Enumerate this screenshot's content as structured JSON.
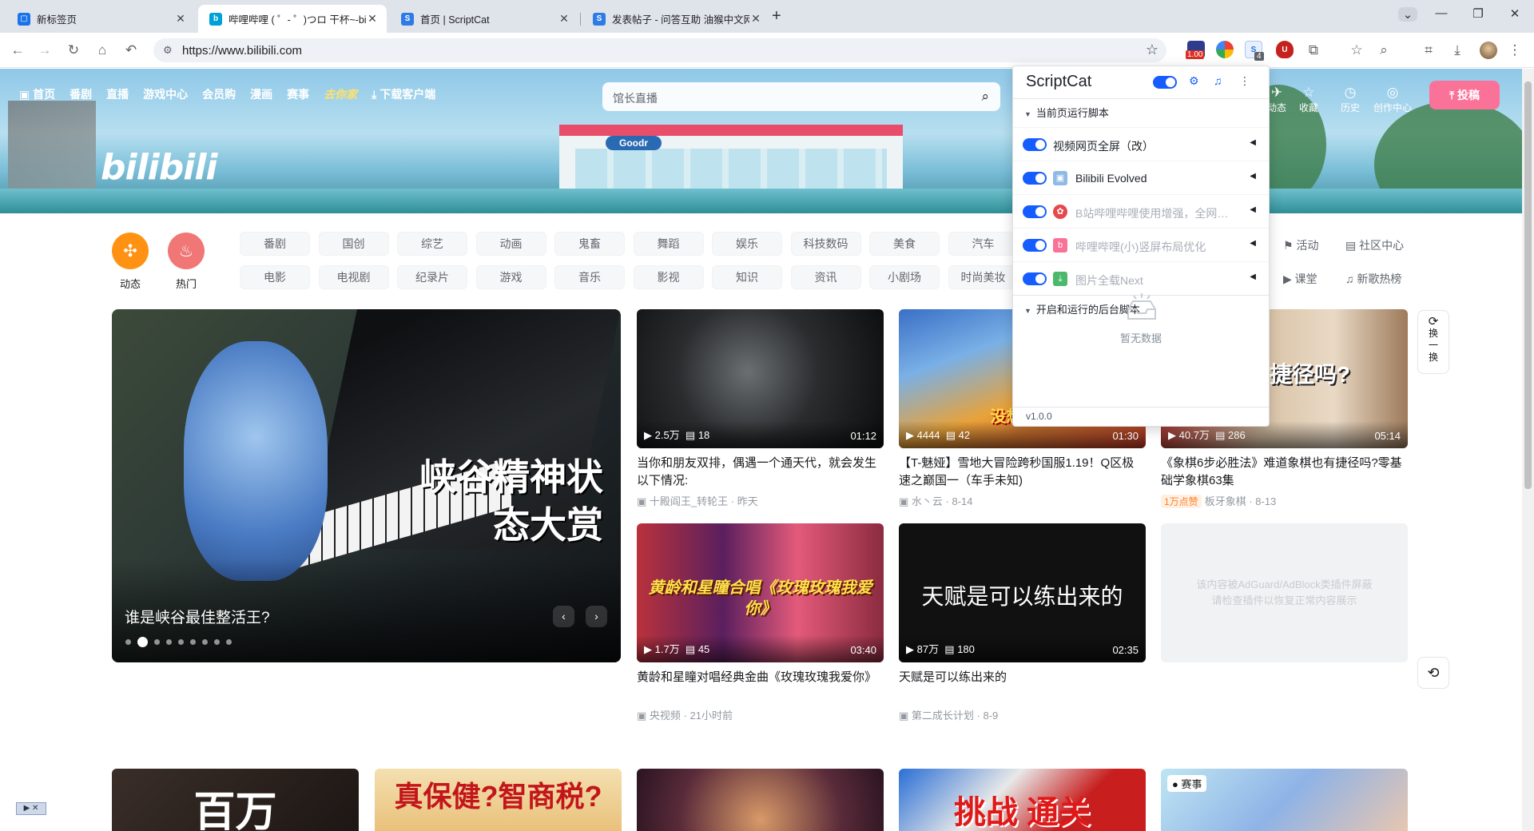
{
  "browser": {
    "tabs": [
      {
        "title": "新标签页"
      },
      {
        "title": "哔哩哔哩 ( ゜- ゜)つロ 干杯~-bilibili"
      },
      {
        "title": "首页 | ScriptCat"
      },
      {
        "title": "发表帖子 - 问答互助 油猴中文网"
      }
    ],
    "url": "https://www.bilibili.com",
    "ext_badge_counts": [
      "1.00",
      "4"
    ]
  },
  "bili": {
    "logo": "bilibili",
    "nav": [
      "首页",
      "番剧",
      "直播",
      "游戏中心",
      "会员购",
      "漫画",
      "赛事",
      "去你家",
      "下载客户端"
    ],
    "search_placeholder": "馆长直播",
    "right_nav": [
      "动态",
      "收藏",
      "历史",
      "创作中心"
    ],
    "upload": "投稿",
    "circles": [
      "动态",
      "热门"
    ],
    "channels_row1": [
      "番剧",
      "国创",
      "综艺",
      "动画",
      "鬼畜",
      "舞蹈",
      "娱乐",
      "科技数码",
      "美食",
      "汽车"
    ],
    "channels_row2": [
      "电影",
      "电视剧",
      "纪录片",
      "游戏",
      "音乐",
      "影视",
      "知识",
      "资讯",
      "小剧场",
      "时尚美妆"
    ],
    "side_links": [
      "活动",
      "社区中心",
      "课堂",
      "新歌热榜"
    ],
    "hero": {
      "big_text": "峡谷精神状态大赏",
      "title": "谁是峡谷最佳整活王?"
    },
    "cards": [
      {
        "views": "2.5万",
        "danmaku": "18",
        "duration": "01:12",
        "title": "当你和朋友双排，偶遇一个通天代，就会发生以下情况:",
        "author": "十殿阎王_转轮王",
        "date": "昨天",
        "badge": ""
      },
      {
        "views": "4444",
        "danmaku": "42",
        "duration": "01:30",
        "title": "【T-魅娅】雪地大冒险跨秒国服1.19！Q区极速之巅国一（车手未知)",
        "author": "水丶云",
        "date": "8-14",
        "badge": "",
        "thumb_text": "没想到加"
      },
      {
        "views": "40.7万",
        "danmaku": "286",
        "duration": "05:14",
        "title": "《象棋6步必胜法》难道象棋也有捷径吗?零基础学象棋63集",
        "author": "板牙象棋",
        "date": "8-13",
        "badge": "1万点赞",
        "thumb_text": "必胜 捷径吗?"
      },
      {
        "views": "1.7万",
        "danmaku": "45",
        "duration": "03:40",
        "title": "黄龄和星瞳对唱经典金曲《玫瑰玫瑰我爱你》",
        "author": "央视频",
        "date": "21小时前",
        "badge": "",
        "thumb_text": "黄龄和星瞳合唱《玫瑰玫瑰我爱你》"
      },
      {
        "views": "87万",
        "danmaku": "180",
        "duration": "02:35",
        "title": "天赋是可以练出来的",
        "author": "第二成长计划",
        "date": "8-9",
        "badge": "",
        "thumb_text": "天赋是可以练出来的"
      }
    ],
    "adblock_text": [
      "该内容被AdGuard/AdBlock类插件屏蔽",
      "请检查插件以恢复正常内容展示"
    ],
    "refresh_text": "换一换",
    "row3_texts": [
      "百万",
      "真保健?智商税?",
      "",
      "挑战 通关",
      "赛事"
    ]
  },
  "scriptcat": {
    "title": "ScriptCat",
    "section_current": "当前页运行脚本",
    "scripts": [
      {
        "name": "视频网页全屏（改）",
        "enabled": true,
        "dim": false
      },
      {
        "name": "Bilibili Evolved",
        "enabled": true,
        "dim": false
      },
      {
        "name": "B站哔哩哔哩使用增强，全网VIP视频...",
        "enabled": true,
        "dim": true
      },
      {
        "name": "哔哩哔哩(小)竖屏布局优化",
        "enabled": true,
        "dim": true
      },
      {
        "name": "图片全载Next",
        "enabled": true,
        "dim": true
      }
    ],
    "section_background": "开启和运行的后台脚本",
    "empty": "暂无数据",
    "version": "v1.0.0"
  }
}
